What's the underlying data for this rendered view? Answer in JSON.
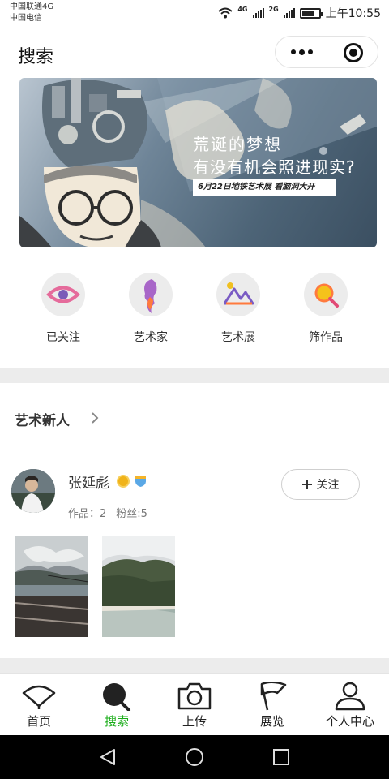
{
  "status_bar": {
    "carrier_1": "中国联通4G",
    "carrier_2": "中国电信",
    "net_1": "4G",
    "net_2": "2G",
    "battery_level": 0.7,
    "time": "上午10:55"
  },
  "nav": {
    "title": "搜索",
    "icons": [
      "more-icon",
      "target-icon"
    ]
  },
  "banner": {
    "headline_1": "荒诞的梦想",
    "headline_2": "有没有机会照进现实?",
    "tag": "6月22日地铁艺术展  看脑洞大开",
    "colors": {
      "background": "#4d6477",
      "tag_bg": "#ffffff"
    }
  },
  "quick_entries": [
    {
      "label": "已关注",
      "icon": "eye-icon"
    },
    {
      "label": "艺术家",
      "icon": "artist-silhouette-icon"
    },
    {
      "label": "艺术展",
      "icon": "mountain-icon"
    },
    {
      "label": "筛作品",
      "icon": "magnifier-icon"
    }
  ],
  "section": {
    "title": "艺术新人"
  },
  "artist": {
    "name": "张延彪",
    "works_label": "作品：2",
    "fans_label": "粉丝:5",
    "follow_label": "关注"
  },
  "tabs": [
    {
      "label": "首页",
      "icon": "home-fan-icon",
      "active": false
    },
    {
      "label": "搜索",
      "icon": "search-icon",
      "active": true
    },
    {
      "label": "上传",
      "icon": "camera-icon",
      "active": false
    },
    {
      "label": "展览",
      "icon": "flag-icon",
      "active": false
    },
    {
      "label": "个人中心",
      "icon": "user-icon",
      "active": false
    }
  ],
  "colors": {
    "accent": "#1aad19",
    "divider": "#ececec",
    "text": "#333333"
  }
}
